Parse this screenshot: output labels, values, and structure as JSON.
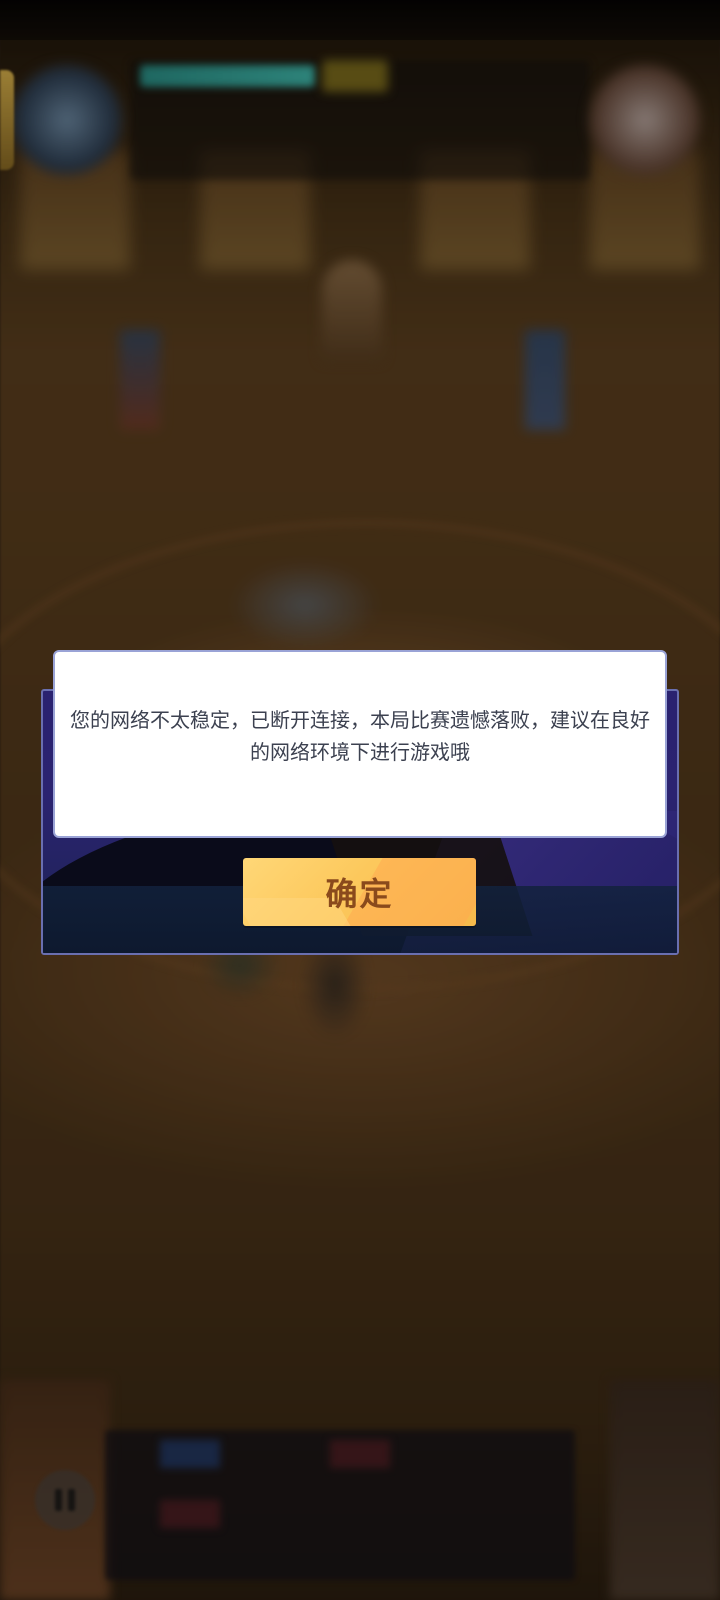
{
  "dialog": {
    "message": "您的网络不太稳定，已断开连接，本局比赛遗憾落败，建议在良好的网络环境下进行游戏哦",
    "confirm_label": "确定"
  },
  "colors": {
    "dialog_frame": "#2a2270",
    "dialog_border": "#6a6fb0",
    "card_border": "#9aa3d6",
    "button_fill": "#fcc85c",
    "button_text": "#8a4a1c",
    "message_text": "#3c4150"
  },
  "icons": {
    "pause": "pause-icon"
  }
}
